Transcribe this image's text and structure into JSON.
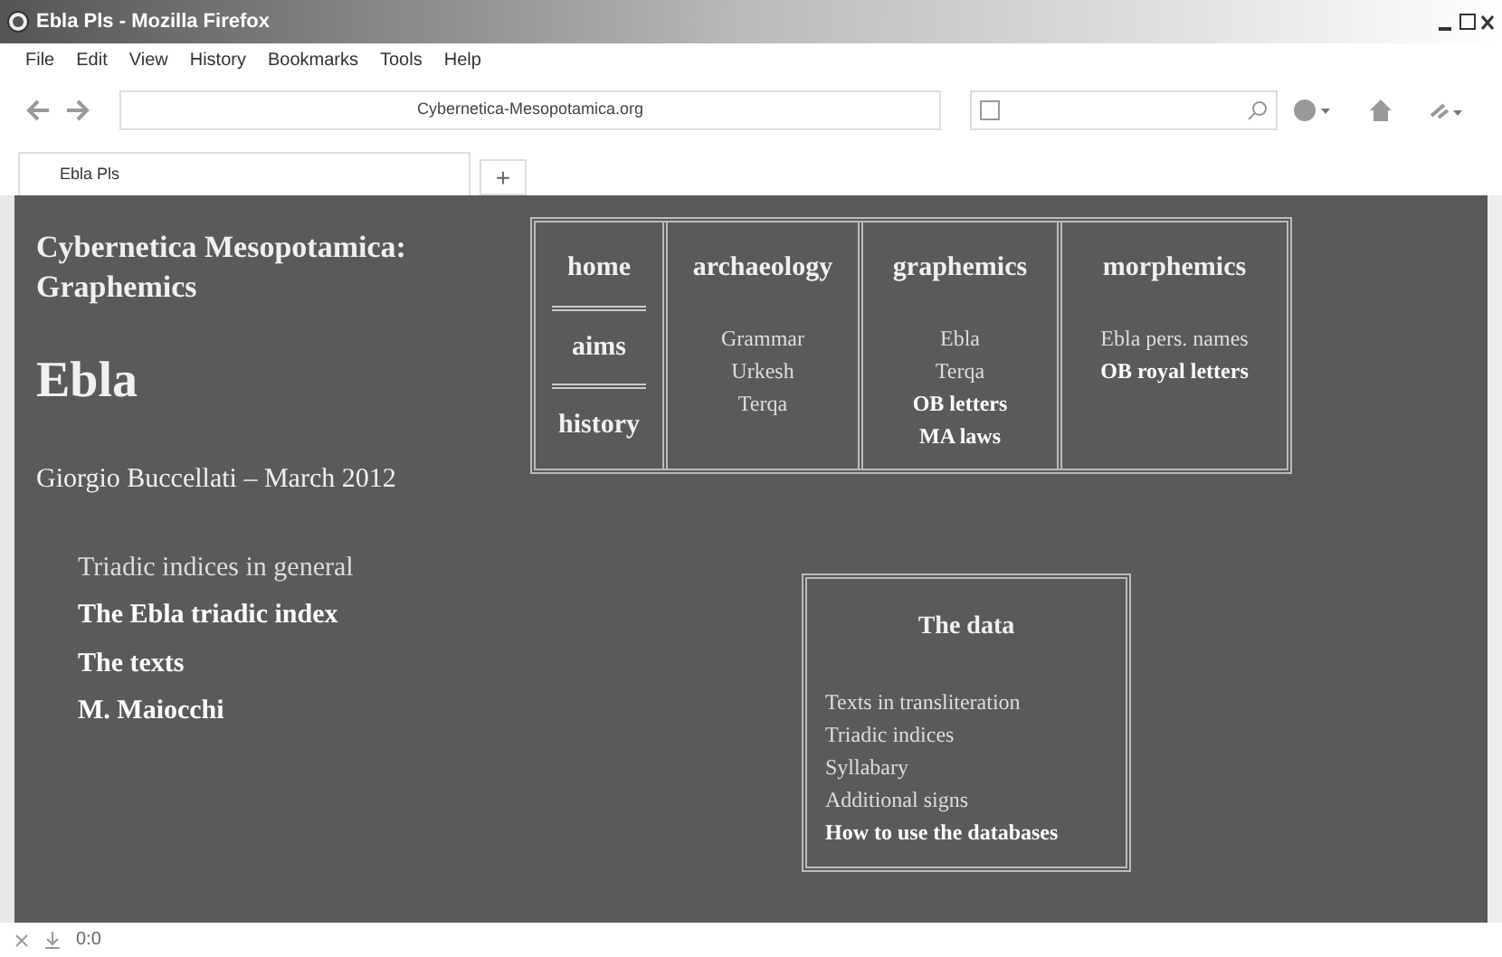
{
  "window": {
    "title": "Ebla Pls - Mozilla Firefox"
  },
  "menu": [
    "File",
    "Edit",
    "View",
    "History",
    "Bookmarks",
    "Tools",
    "Help"
  ],
  "address": {
    "value": "Cybernetica-Mesopotamica.org"
  },
  "tabs": [
    {
      "label": "Ebla Pls",
      "selected": true
    }
  ],
  "new_tab": "+",
  "page": {
    "site_title": "Cybernetica Mesopotamica: Graphemics",
    "heading": "Ebla",
    "byline": "Giorgio Buccellati – March 2012",
    "links": [
      {
        "label": "Triadic indices in general",
        "bold": false
      },
      {
        "label": "The Ebla triadic index",
        "bold": true
      },
      {
        "label": "The texts",
        "bold": true
      },
      {
        "label": "M. Maiocchi",
        "bold": true
      }
    ]
  },
  "nav": {
    "main": [
      "home",
      "aims",
      "history"
    ],
    "columns": [
      {
        "heading": "archaeology",
        "items": [
          {
            "label": "Grammar",
            "bold": false
          },
          {
            "label": "Urkesh",
            "bold": false
          },
          {
            "label": "Terqa",
            "bold": false
          }
        ]
      },
      {
        "heading": "graphemics",
        "items": [
          {
            "label": "Ebla",
            "bold": false
          },
          {
            "label": "Terqa",
            "bold": false
          },
          {
            "label": "OB letters",
            "bold": true
          },
          {
            "label": "MA laws",
            "bold": true
          }
        ]
      },
      {
        "heading": "morphemics",
        "items": [
          {
            "label": "Ebla pers. names",
            "bold": false
          },
          {
            "label": "OB royal letters",
            "bold": true
          }
        ]
      }
    ]
  },
  "data_box": {
    "title": "The data",
    "items": [
      {
        "label": "Texts in transliteration",
        "bold": false
      },
      {
        "label": "Triadic indices",
        "bold": false
      },
      {
        "label": "Syllabary",
        "bold": false
      },
      {
        "label": "Additional signs",
        "bold": false
      },
      {
        "label": "How to use the databases",
        "bold": true
      }
    ]
  },
  "status_bar": {
    "text": "0:0"
  }
}
